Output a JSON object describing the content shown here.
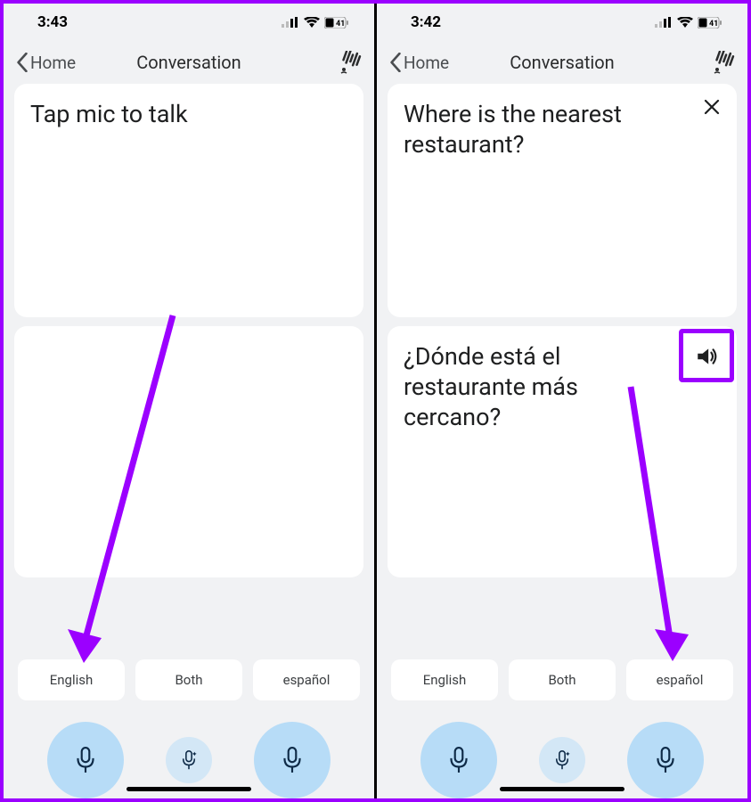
{
  "left": {
    "status_time": "3:43",
    "battery": "41",
    "back_label": "Home",
    "title": "Conversation",
    "source_text": "Tap mic to talk",
    "translated_text": "",
    "lang1": "English",
    "lang_both": "Both",
    "lang2": "español"
  },
  "right": {
    "status_time": "3:42",
    "battery": "41",
    "back_label": "Home",
    "title": "Conversation",
    "source_text": "Where is the nearest restaurant?",
    "translated_text": "¿Dónde está el restaurante más cercano?",
    "lang1": "English",
    "lang_both": "Both",
    "lang2": "español"
  },
  "colors": {
    "accent": "#9b00ff",
    "mic_bg": "#b7dcf7"
  }
}
